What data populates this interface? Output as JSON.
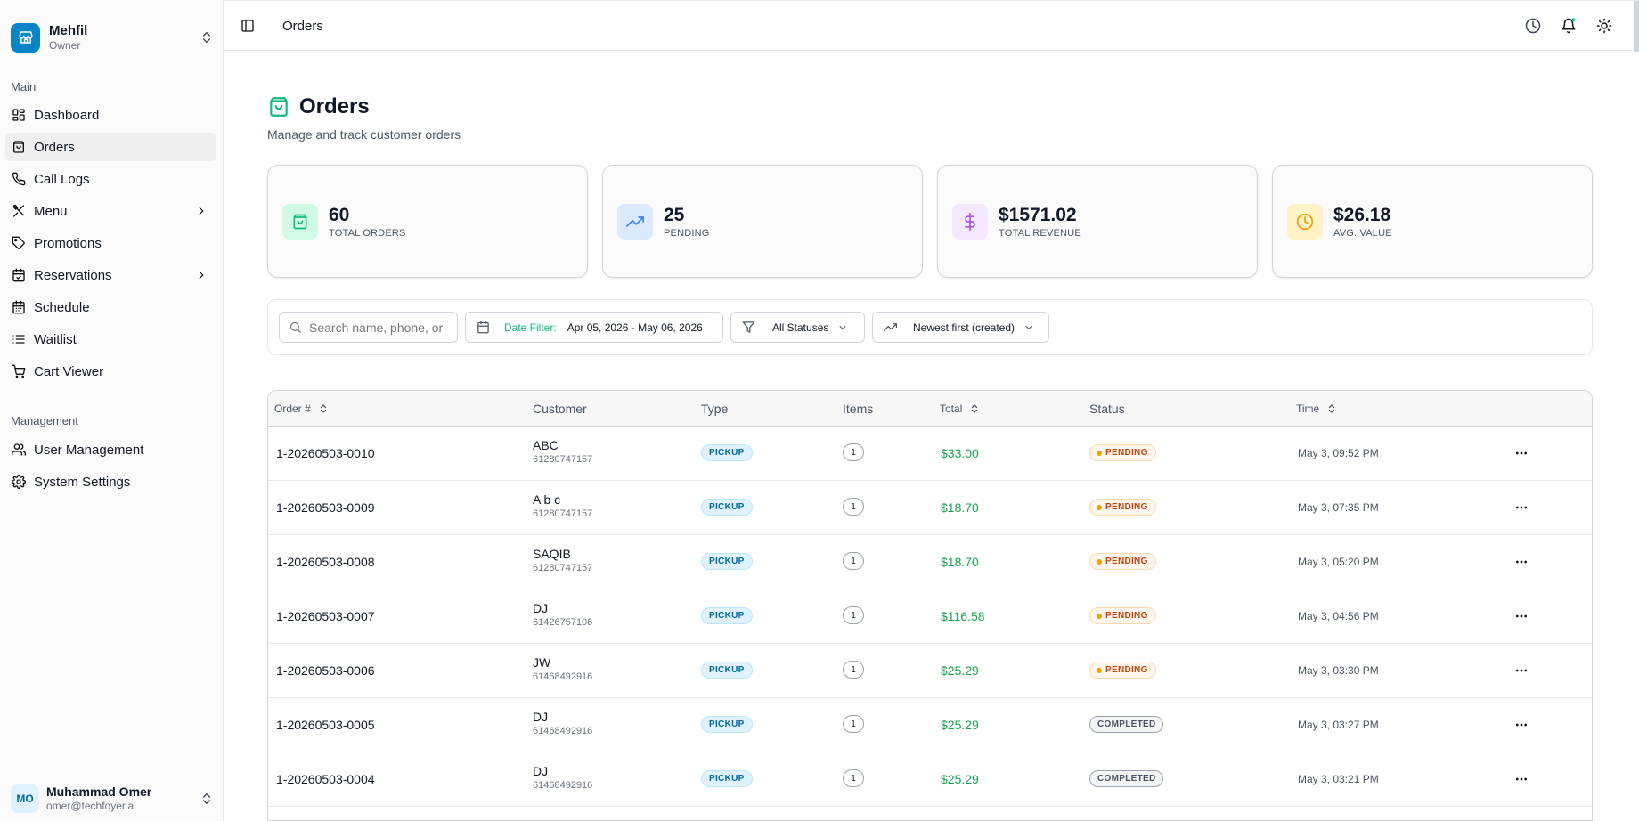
{
  "brand": {
    "name": "Mehfil",
    "role": "Owner"
  },
  "sidebar": {
    "main_label": "Main",
    "main_items": [
      {
        "label": "Dashboard",
        "icon": "layout-dashboard-icon"
      },
      {
        "label": "Orders",
        "icon": "shopping-bag-icon",
        "active": true
      },
      {
        "label": "Call Logs",
        "icon": "phone-icon"
      },
      {
        "label": "Menu",
        "icon": "utensils-icon",
        "expandable": true
      },
      {
        "label": "Promotions",
        "icon": "tag-icon"
      },
      {
        "label": "Reservations",
        "icon": "calendar-check-icon",
        "expandable": true
      },
      {
        "label": "Schedule",
        "icon": "calendar-icon"
      },
      {
        "label": "Waitlist",
        "icon": "list-icon"
      },
      {
        "label": "Cart Viewer",
        "icon": "cart-icon"
      }
    ],
    "management_label": "Management",
    "management_items": [
      {
        "label": "User Management",
        "icon": "users-icon"
      },
      {
        "label": "System Settings",
        "icon": "gear-icon"
      }
    ]
  },
  "user": {
    "initials": "MO",
    "name": "Muhammad Omer",
    "email": "omer@techfoyer.ai"
  },
  "topbar": {
    "breadcrumb": "Orders"
  },
  "page": {
    "title": "Orders",
    "subtitle": "Manage and track customer orders"
  },
  "stats": [
    {
      "value": "60",
      "label": "TOTAL ORDERS",
      "color": "#10b981"
    },
    {
      "value": "25",
      "label": "PENDING",
      "color": "#3b82f6"
    },
    {
      "value": "$1571.02",
      "label": "TOTAL REVENUE",
      "color": "#a855f7"
    },
    {
      "value": "$26.18",
      "label": "AVG. VALUE",
      "color": "#f59e0b"
    }
  ],
  "filters": {
    "search_placeholder": "Search name, phone, or order",
    "date_label": "Date Filter:",
    "date_range": "Apr 05, 2026 - May 06, 2026",
    "status": "All Statuses",
    "sort": "Newest first (created)"
  },
  "table": {
    "headers": {
      "order": "Order #",
      "customer": "Customer",
      "type": "Type",
      "items": "Items",
      "total": "Total",
      "status": "Status",
      "time": "Time"
    },
    "rows": [
      {
        "order": "1-20260503-0010",
        "name": "ABC",
        "phone": "61280747157",
        "type": "PICKUP",
        "items": "1",
        "total": "$33.00",
        "status": "PENDING",
        "time": "May 3, 09:52 PM"
      },
      {
        "order": "1-20260503-0009",
        "name": "A b c",
        "phone": "61280747157",
        "type": "PICKUP",
        "items": "1",
        "total": "$18.70",
        "status": "PENDING",
        "time": "May 3, 07:35 PM"
      },
      {
        "order": "1-20260503-0008",
        "name": "SAQIB",
        "phone": "61280747157",
        "type": "PICKUP",
        "items": "1",
        "total": "$18.70",
        "status": "PENDING",
        "time": "May 3, 05:20 PM"
      },
      {
        "order": "1-20260503-0007",
        "name": "DJ",
        "phone": "61426757106",
        "type": "PICKUP",
        "items": "1",
        "total": "$116.58",
        "status": "PENDING",
        "time": "May 3, 04:56 PM"
      },
      {
        "order": "1-20260503-0006",
        "name": "JW",
        "phone": "61468492916",
        "type": "PICKUP",
        "items": "1",
        "total": "$25.29",
        "status": "PENDING",
        "time": "May 3, 03:30 PM"
      },
      {
        "order": "1-20260503-0005",
        "name": "DJ",
        "phone": "61468492916",
        "type": "PICKUP",
        "items": "1",
        "total": "$25.29",
        "status": "COMPLETED",
        "time": "May 3, 03:27 PM"
      },
      {
        "order": "1-20260503-0004",
        "name": "DJ",
        "phone": "61468492916",
        "type": "PICKUP",
        "items": "1",
        "total": "$25.29",
        "status": "COMPLETED",
        "time": "May 3, 03:21 PM"
      }
    ]
  }
}
